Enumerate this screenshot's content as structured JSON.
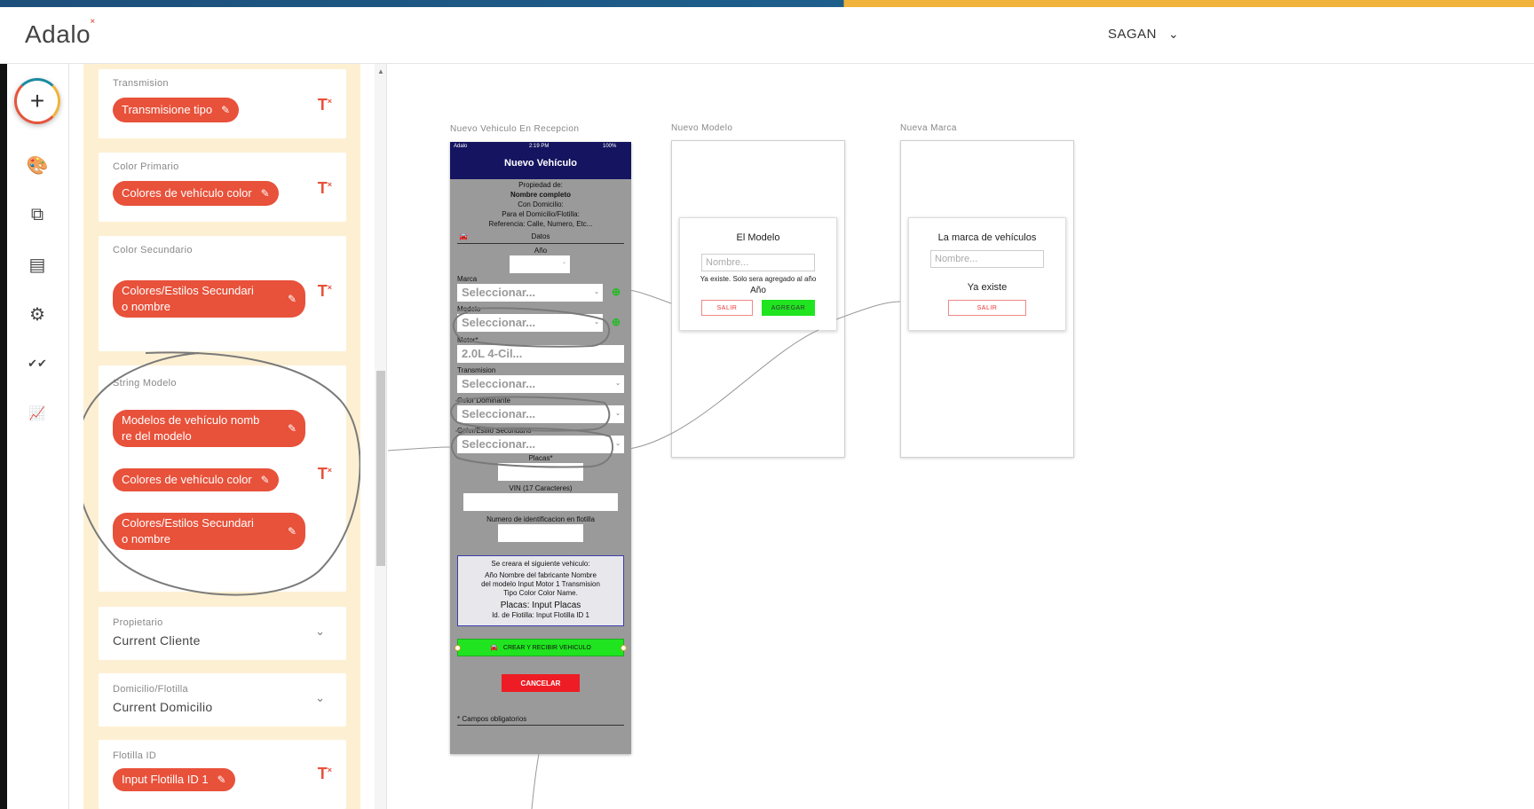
{
  "app": {
    "logo": "Adalo",
    "logo_mark": "˟",
    "user": "SAGAN",
    "user_chevron": "⌄"
  },
  "nav": {
    "add": "+",
    "items": [
      {
        "name": "branding-palette-icon",
        "glyph": "🎨"
      },
      {
        "name": "screens-icon",
        "glyph": "⧉"
      },
      {
        "name": "database-icon",
        "glyph": "▤"
      },
      {
        "name": "settings-gear-icon",
        "glyph": "⚙"
      },
      {
        "name": "publish-check-icon",
        "glyph": "✔✔"
      },
      {
        "name": "analytics-chart-icon",
        "glyph": "📈"
      }
    ]
  },
  "panel": {
    "transmision": {
      "label": "Transmision",
      "pill": "Transmisione tipo"
    },
    "color_primario": {
      "label": "Color Primario",
      "pill": "Colores de vehículo color"
    },
    "color_secundario": {
      "label": "Color Secundario",
      "pill_line1": "Colores/Estilos Secundari",
      "pill_line2": "o nombre"
    },
    "string_modelo": {
      "label": "String Modelo",
      "pill1_line1": "Modelos de vehículo nomb",
      "pill1_line2": "re del modelo",
      "pill2": "Colores de vehículo color",
      "pill3_line1": "Colores/Estilos Secundari",
      "pill3_line2": "o nombre"
    },
    "propietario": {
      "label": "Propietario",
      "value": "Current Cliente"
    },
    "domicilio": {
      "label": "Domicilio/Flotilla",
      "value": "Current Domicilio"
    },
    "flotilla": {
      "label": "Flotilla ID",
      "pill": "Input Flotilla ID 1"
    },
    "magic_text": "T",
    "magic_sup": "×",
    "pen": "✎",
    "chevron": "⌄"
  },
  "canvas": {
    "screen1": {
      "label": "Nuevo Vehiculo En Recepcion",
      "status_left": "Adalo",
      "status_time": "2:19 PM",
      "status_right": "100%",
      "title": "Nuevo Vehículo",
      "propiedad": "Propiedad de:",
      "nombre": "Nombre completo",
      "con_domicilio": "Con Domicilio:",
      "para": "Para el Domicilio/Flotilla:",
      "referencia": "Referencia: Calle, Numero, Etc...",
      "datos": "Datos",
      "anio": "Año",
      "marca": "Marca",
      "select_placeholder": "Seleccionar...",
      "modelo": "Modelo",
      "motor": "Motor*",
      "motor_value": "2.0L 4-Cil...",
      "transmision": "Transmision",
      "color_dominante": "Color Dominante",
      "color_secundario": "Color/Estilo Secundario",
      "placas": "Placas*",
      "vin": "VIN (17 Caracteres)",
      "numero_id": "Numero de identificacion en flotilla",
      "summary_title": "Se creara el siguiente vehiculo:",
      "summary_l1": "Año Nombre del fabricante Nombre",
      "summary_l2": "del modelo Input Motor 1 Transmision",
      "summary_l3": "Tipo Color Color Name.",
      "summary_placas": "Placas: Input Placas",
      "summary_flotilla": "Id. de Flotilla: Input Flotilla ID 1",
      "create_btn": "CREAR Y RECIBIR VEHICULO",
      "cancel_btn": "CANCELAR",
      "required_note": "* Campos obligatorios"
    },
    "screen2": {
      "label": "Nuevo Modelo",
      "modal_title": "El Modelo",
      "placeholder": "Nombre...",
      "exists_note": "Ya existe. Solo sera agregado al año",
      "anio": "Año",
      "salir": "SALIR",
      "agregar": "AGREGAR"
    },
    "screen3": {
      "label": "Nueva Marca",
      "modal_title": "La marca de vehículos",
      "placeholder": "Nombre...",
      "exists": "Ya existe",
      "salir": "SALIR"
    }
  },
  "colors": {
    "accent": "#e8513a",
    "panel_bg": "#fdf0d2",
    "phone_header": "#141460",
    "green": "#1fe41f",
    "red": "#ee1c24"
  }
}
